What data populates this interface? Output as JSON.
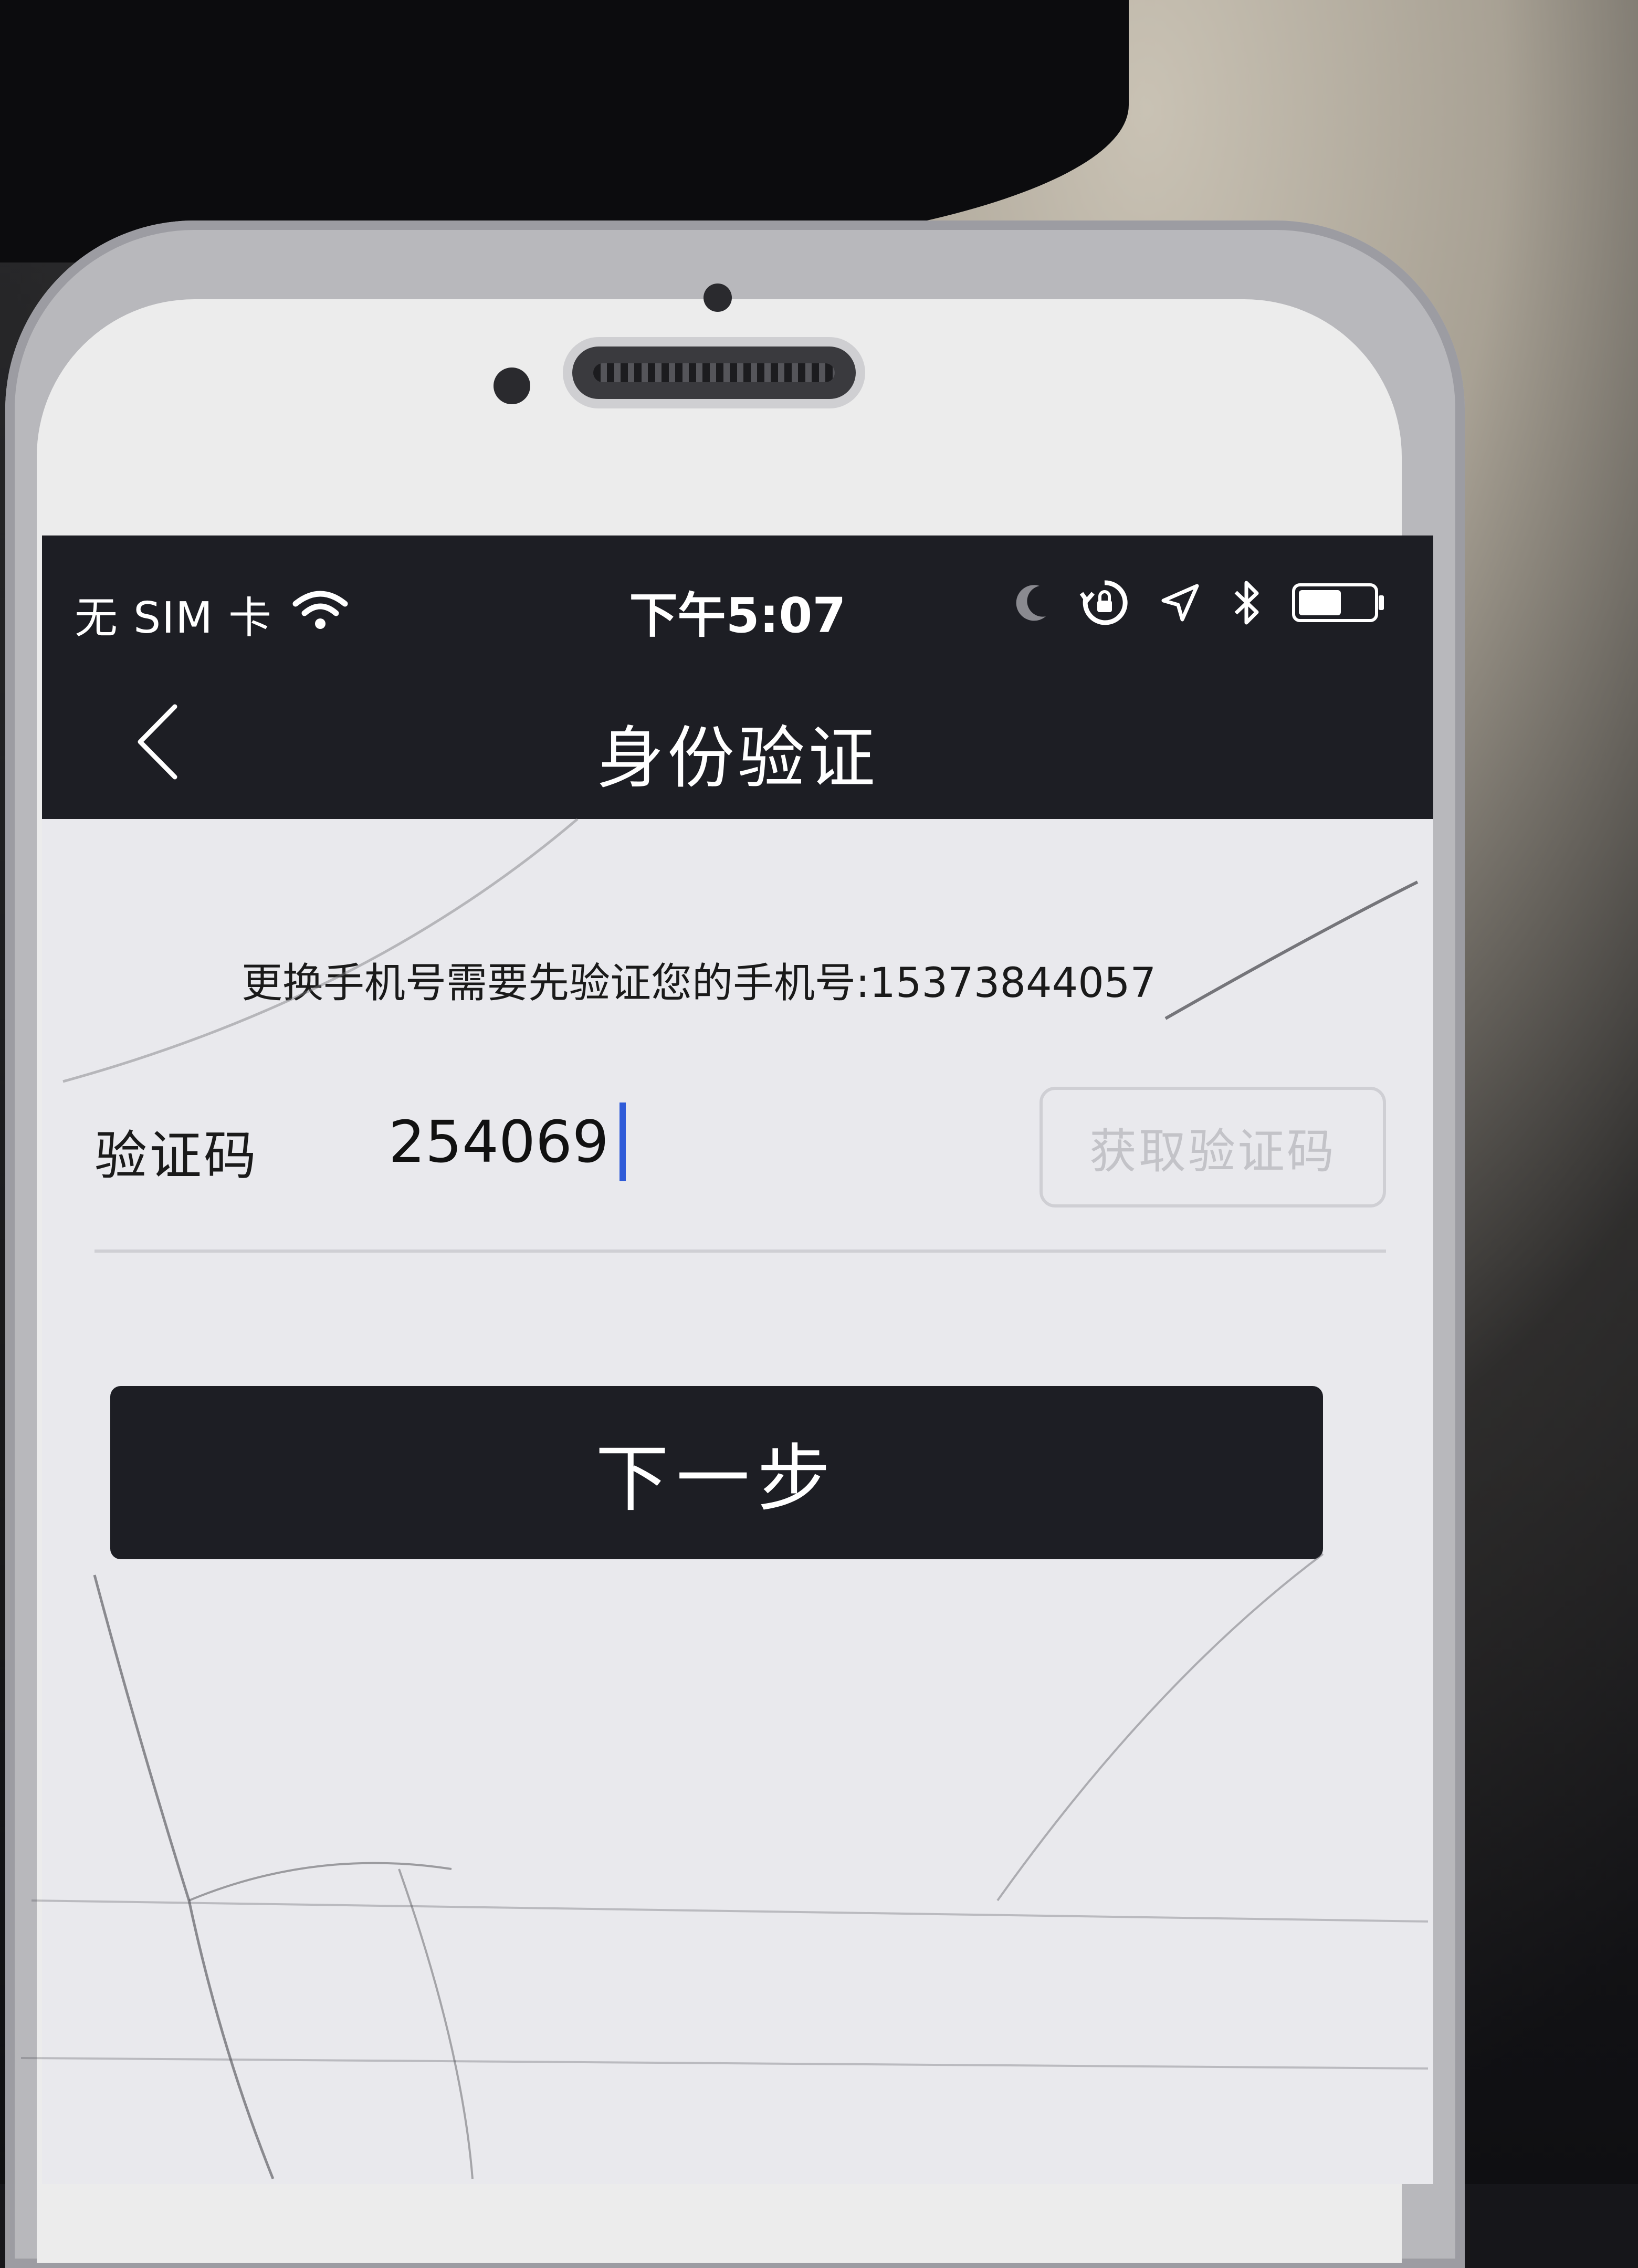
{
  "status_bar": {
    "carrier": "无 SIM 卡",
    "time": "下午5:07",
    "icons": [
      "wifi-icon",
      "moon-icon",
      "rotation-lock-icon",
      "location-icon",
      "bluetooth-icon",
      "battery-icon"
    ]
  },
  "nav": {
    "back_icon": "chevron-left-icon",
    "title": "身份验证"
  },
  "notice": "更换手机号需要先验证您的手机号:15373844057",
  "code": {
    "label": "验证码",
    "value": "254069",
    "get_code_button": "获取验证码"
  },
  "next_button": "下一步",
  "colors": {
    "bar": "#1d1e24",
    "screen_bg": "#e9e9ed",
    "caret": "#2f5bd8",
    "disabled_text": "#c3c3c8"
  }
}
